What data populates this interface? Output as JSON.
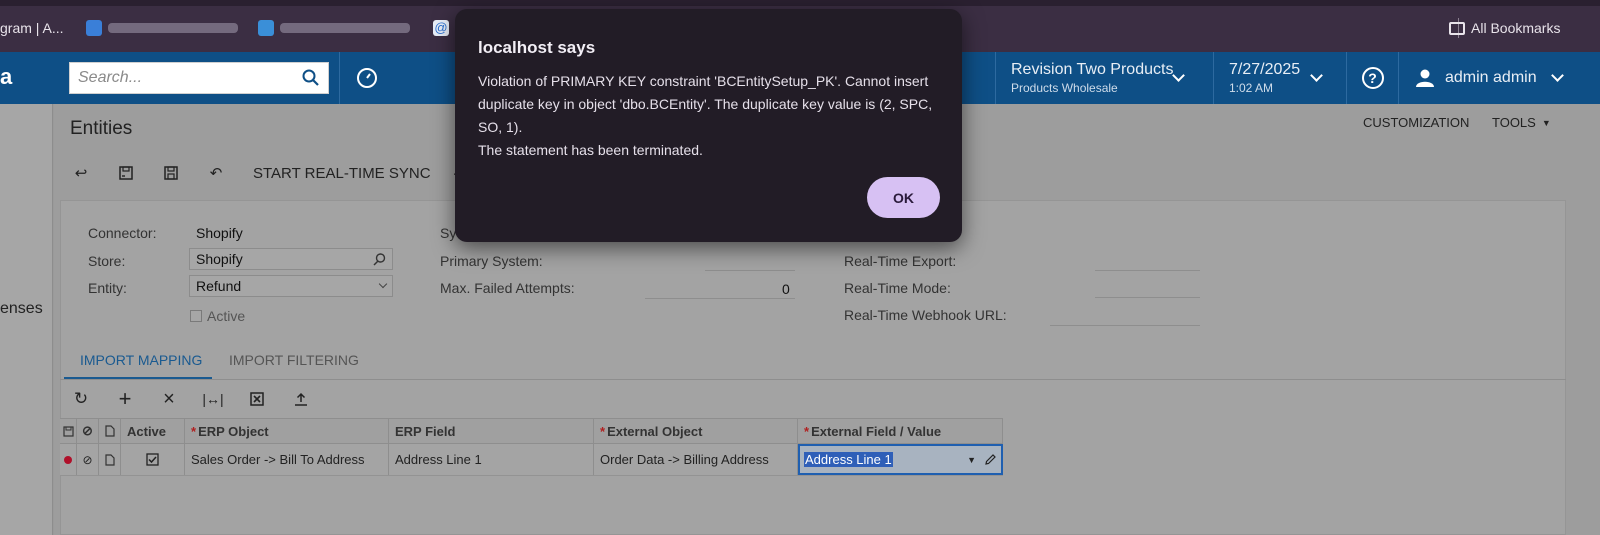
{
  "bookmarks": {
    "items": [
      {
        "label": "gram | A..."
      },
      {
        "label": ""
      },
      {
        "label": ""
      },
      {
        "label": ""
      }
    ],
    "all_bookmarks": "All Bookmarks"
  },
  "header": {
    "logo_fragment": "a",
    "search_placeholder": "Search...",
    "company": "Revision Two Products",
    "branch": "Products Wholesale",
    "date": "7/27/2025",
    "time": "1:02 AM",
    "help": "?",
    "user": "admin admin"
  },
  "page": {
    "title": "Entities",
    "customization": "CUSTOMIZATION",
    "tools": "TOOLS",
    "rail_text": "enses",
    "toolbar": {
      "start_sync": "START REAL-TIME SYNC"
    }
  },
  "form": {
    "connector_label": "Connector:",
    "connector_value": "Shopify",
    "store_label": "Store:",
    "store_value": "Shopify",
    "entity_label": "Entity:",
    "entity_value": "Refund",
    "active_label": "Active",
    "sync_label": "Sy",
    "primary_system_label": "Primary System:",
    "max_failed_label": "Max. Failed Attempts:",
    "max_failed_value": "0",
    "rt_export_label": "Real-Time Export:",
    "rt_mode_label": "Real-Time Mode:",
    "rt_webhook_label": "Real-Time Webhook URL:"
  },
  "tabs": [
    {
      "label": "IMPORT MAPPING",
      "active": true
    },
    {
      "label": "IMPORT FILTERING",
      "active": false
    }
  ],
  "grid": {
    "columns": [
      "Active",
      "ERP Object",
      "ERP Field",
      "External Object",
      "External Field / Value"
    ],
    "rows": [
      {
        "active": true,
        "erp_object": "Sales Order -> Bill To Address",
        "erp_field": "Address Line 1",
        "external_object": "Order Data -> Billing Address",
        "external_field": "Address Line 1"
      }
    ]
  },
  "dialog": {
    "title": "localhost says",
    "message": "Violation of PRIMARY KEY constraint 'BCEntitySetup_PK'. Cannot insert duplicate key in object 'dbo.BCEntity'. The duplicate key value is (2, SPC, SO, 1).\nThe statement has been terminated.",
    "ok_label": "OK"
  },
  "colors": {
    "header_blue": "#0e4f86",
    "dialog_bg": "#221c26",
    "ok_button": "#d7c1f3",
    "tab_active": "#1a5a90"
  }
}
